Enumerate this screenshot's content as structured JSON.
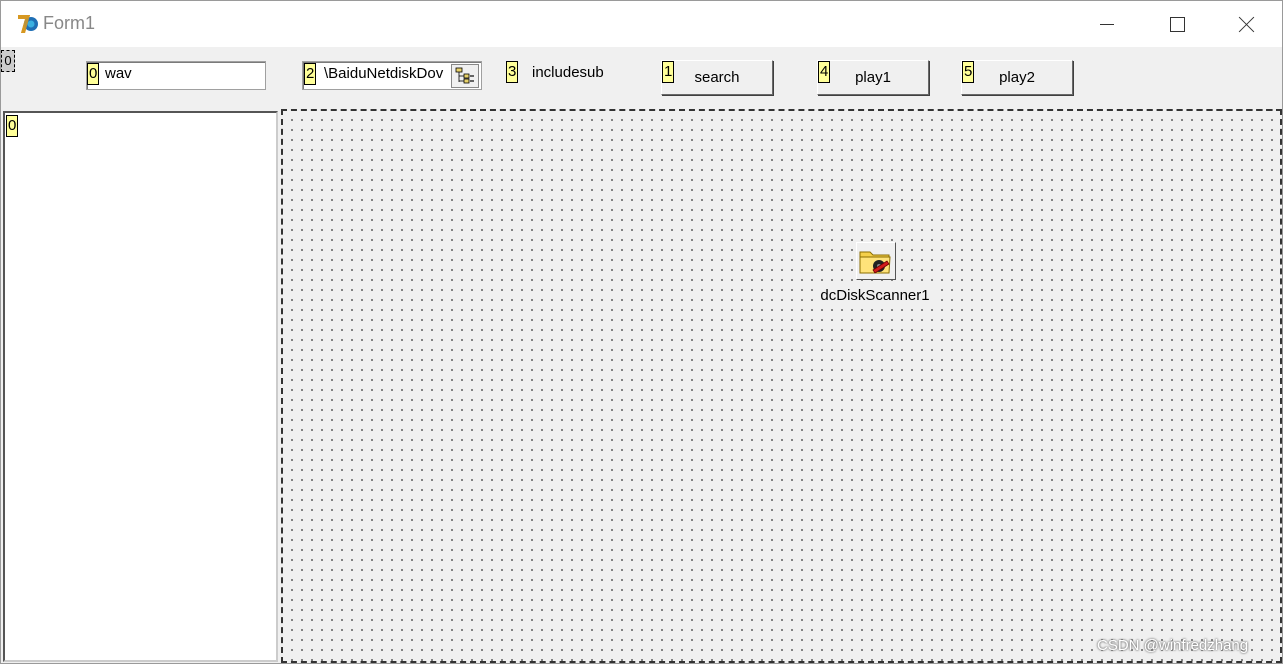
{
  "window": {
    "title": "Form1",
    "controls": [
      "minimize-icon",
      "maximize-icon",
      "close-icon"
    ]
  },
  "toolbar": {
    "corner_tag": "0",
    "ext_input": {
      "tag": "0",
      "value": "wav"
    },
    "path_input": {
      "tag": "2",
      "value": "\\BaiduNetdiskDov",
      "browse_icon": "tree-browse-icon"
    },
    "include_sub": {
      "tag": "3",
      "label": "includesub"
    },
    "search_button": {
      "tag": "1",
      "label": "search"
    },
    "play1_button": {
      "tag": "4",
      "label": "play1"
    },
    "play2_button": {
      "tag": "5",
      "label": "play2"
    }
  },
  "left_panel": {
    "tag": "0"
  },
  "design_area": {
    "component": {
      "name": "dcDiskScanner1",
      "icon": "disk-scanner-folder-icon"
    }
  },
  "watermark": "CSDN @winfredzhang",
  "colors": {
    "tag_bg": "#ffff99",
    "form_bg": "#f0f0f0",
    "title_bg": "#ffffff"
  }
}
